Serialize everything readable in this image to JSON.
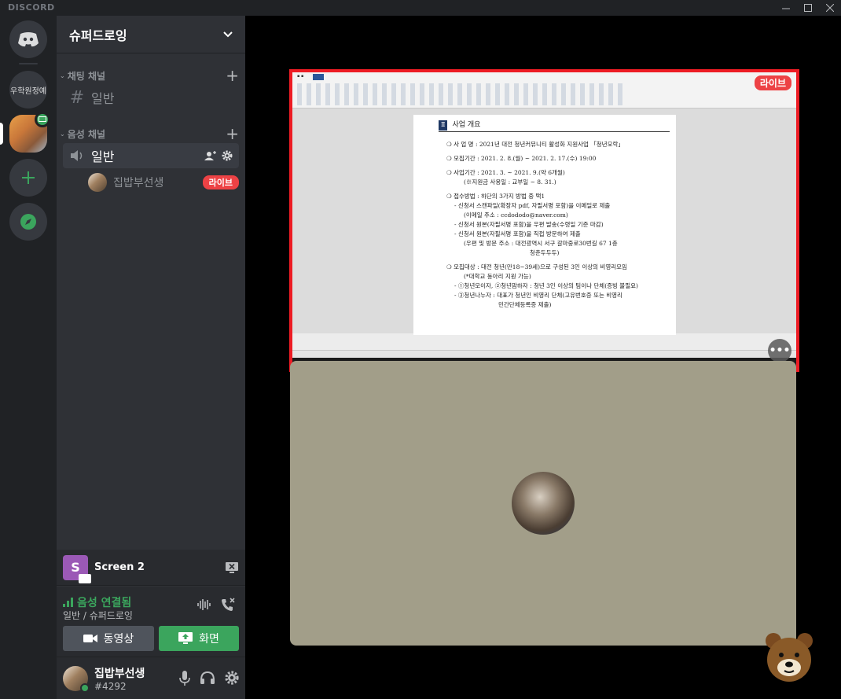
{
  "titlebar": {
    "brand": "DISCORD"
  },
  "rail": {
    "server_text": "우학원정예"
  },
  "guild": {
    "name": "슈퍼드로잉"
  },
  "categories": {
    "text": "채팅 채널",
    "voice": "음성 채널"
  },
  "channels": {
    "text_general": "일반",
    "voice_general": "일반"
  },
  "voice_user": {
    "name": "집밥부선생",
    "badge": "라이브"
  },
  "screen_panel": {
    "icon_letter": "S",
    "name": "Screen 2"
  },
  "rtc": {
    "status": "음성 연결됨",
    "channel": "일반 / 슈퍼드로잉",
    "video_label": "동영상",
    "screen_label": "화면"
  },
  "user": {
    "name": "집밥부선생",
    "tag": "#4292"
  },
  "stream": {
    "live_label": "라이브",
    "doc_heading_num": "Ⅱ",
    "doc_heading": "사업 개요",
    "lines": [
      "❍ 사 업 명 : 2021년 대전 청년커뮤니티 활성화 지원사업 「청년모락」",
      "❍ 모집기간 : 2021. 2. 8.(월) ~ 2021. 2. 17.(수) 19:00",
      "❍ 사업기간 : 2021. 3. ~ 2021. 9.(약 6개월)",
      "(※지원금 사용일 : 교부일 ~ 8. 31.)",
      "❍ 접수방법 : 하단의 3가지 방법 중 택1",
      "- 신청서 스캔파일(확장자 pdf, 자필서명 포함)을 이메일로 제출",
      "(이메일 주소 : ccdododo@naver.com)",
      "- 신청서 원본(자필서명 포함)을 우편 발송(수령일 기준 마감)",
      "- 신청서 원본(자필서명 포함)을 직접 방문하여 제출",
      "(우편 및 방문 주소 : 대전광역시 서구 갈마중로30번길 67 1층",
      "청춘두두두)",
      "❍ 모집대상 : 대전 청년(만18~39세)으로 구성된 3인 이상의 비영리모임",
      "(*대학교 동아리 지원 가능)",
      "- ①청년모이자, ②청년맘하자 : 청년 3인 이상의 팀이나 단체(증빙 불필요)",
      "- ③청년나누자 : 대표가 청년인 비영리 단체(고유번호증 또는 비영리",
      "민간단체등록증 제출)"
    ]
  },
  "colors": {
    "accent_green": "#3ba55d",
    "live_red": "#ed4245",
    "stream_border": "#ed1c24"
  }
}
